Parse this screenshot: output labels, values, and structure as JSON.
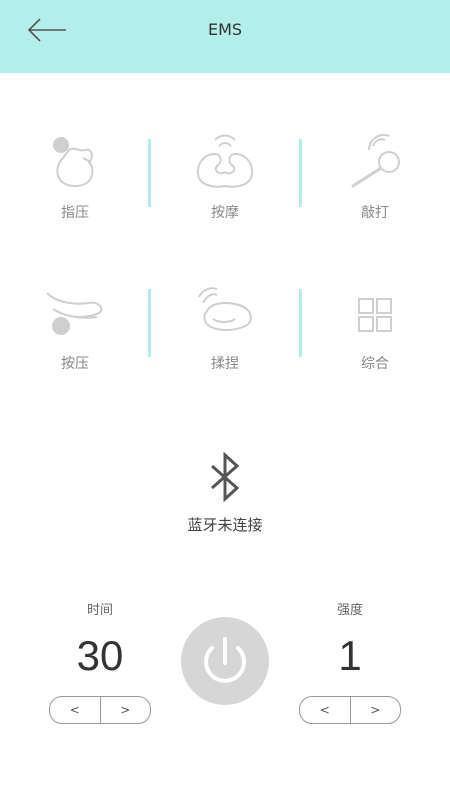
{
  "header": {
    "title": "EMS",
    "back_icon": "arrow-left-icon"
  },
  "modes": [
    {
      "label": "指压",
      "icon": "finger-press-icon"
    },
    {
      "label": "按摩",
      "icon": "massage-hands-icon"
    },
    {
      "label": "敲打",
      "icon": "tapping-hammer-icon"
    },
    {
      "label": "按压",
      "icon": "hand-press-icon"
    },
    {
      "label": "揉捏",
      "icon": "kneading-hand-icon"
    },
    {
      "label": "综合",
      "icon": "grid-icon"
    }
  ],
  "bluetooth": {
    "icon": "bluetooth-icon",
    "status": "蓝牙未连接"
  },
  "time": {
    "label": "时间",
    "value": "30",
    "decrement": "<",
    "increment": ">"
  },
  "intensity": {
    "label": "强度",
    "value": "1",
    "decrement": "<",
    "increment": ">"
  },
  "power": {
    "icon": "power-icon"
  },
  "colors": {
    "accent": "#b3eeea",
    "icon_gray": "#cfcfcf",
    "power_bg": "#d6d6d6"
  }
}
